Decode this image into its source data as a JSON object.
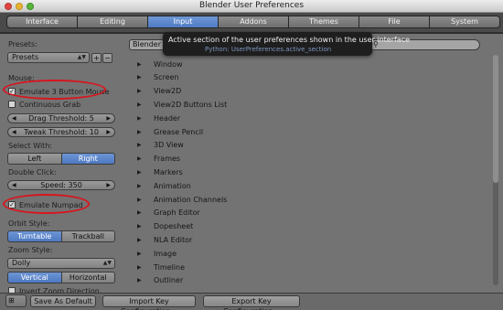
{
  "window": {
    "title": "Blender User Preferences"
  },
  "tabs": [
    {
      "label": "Interface",
      "active": false
    },
    {
      "label": "Editing",
      "active": false
    },
    {
      "label": "Input",
      "active": true
    },
    {
      "label": "Addons",
      "active": false
    },
    {
      "label": "Themes",
      "active": false
    },
    {
      "label": "File",
      "active": false
    },
    {
      "label": "System",
      "active": false
    }
  ],
  "left_panel": {
    "presets_label": "Presets:",
    "presets_value": "Presets",
    "add_preset_glyph": "+",
    "remove_preset_glyph": "−",
    "mouse_label": "Mouse:",
    "emulate_3_button_mouse": {
      "label": "Emulate 3 Button Mouse",
      "checked": true
    },
    "continuous_grab": {
      "label": "Continuous Grab",
      "checked": false
    },
    "drag_threshold": "Drag Threshold: 5",
    "tweak_threshold": "Tweak Threshold: 10",
    "select_with_label": "Select With:",
    "select_with": {
      "left": "Left",
      "right": "Right",
      "active": "Right"
    },
    "double_click_label": "Double Click:",
    "speed": "Speed: 350",
    "emulate_numpad": {
      "label": "Emulate Numpad",
      "checked": true
    },
    "orbit_style_label": "Orbit Style:",
    "orbit_style": {
      "turntable": "Turntable",
      "trackball": "Trackball",
      "active": "Turntable"
    },
    "zoom_style_label": "Zoom Style:",
    "zoom_style_value": "Dolly",
    "zoom_axis": {
      "vertical": "Vertical",
      "horizontal": "Horizontal",
      "active": "Vertical"
    },
    "invert_zoom_direction": {
      "label": "Invert Zoom Direction",
      "checked": false
    }
  },
  "right_panel": {
    "filter_value": "Blender",
    "search_icon_glyph": "⚲",
    "tooltip": {
      "text": "Active section of the user preferences shown in the user interface",
      "python": "Python: UserPreferences.active_section"
    },
    "categories": [
      "Window",
      "Screen",
      "View2D",
      "View2D Buttons List",
      "Header",
      "Grease Pencil",
      "3D View",
      "Frames",
      "Markers",
      "Animation",
      "Animation Channels",
      "Graph Editor",
      "Dopesheet",
      "NLA Editor",
      "Image",
      "Timeline",
      "Outliner"
    ]
  },
  "footer": {
    "editor_type_glyph": "⊞",
    "save_as_default": "Save As Default",
    "import_key_configuration": "Import Key Configuration...",
    "export_key_configuration": "Export Key Configuration..."
  },
  "colors": {
    "active_tab": "#5a86cb",
    "annotation_ring": "#d9141c",
    "panel_bg": "#737373",
    "tooltip_bg": "#1e1e1e"
  }
}
